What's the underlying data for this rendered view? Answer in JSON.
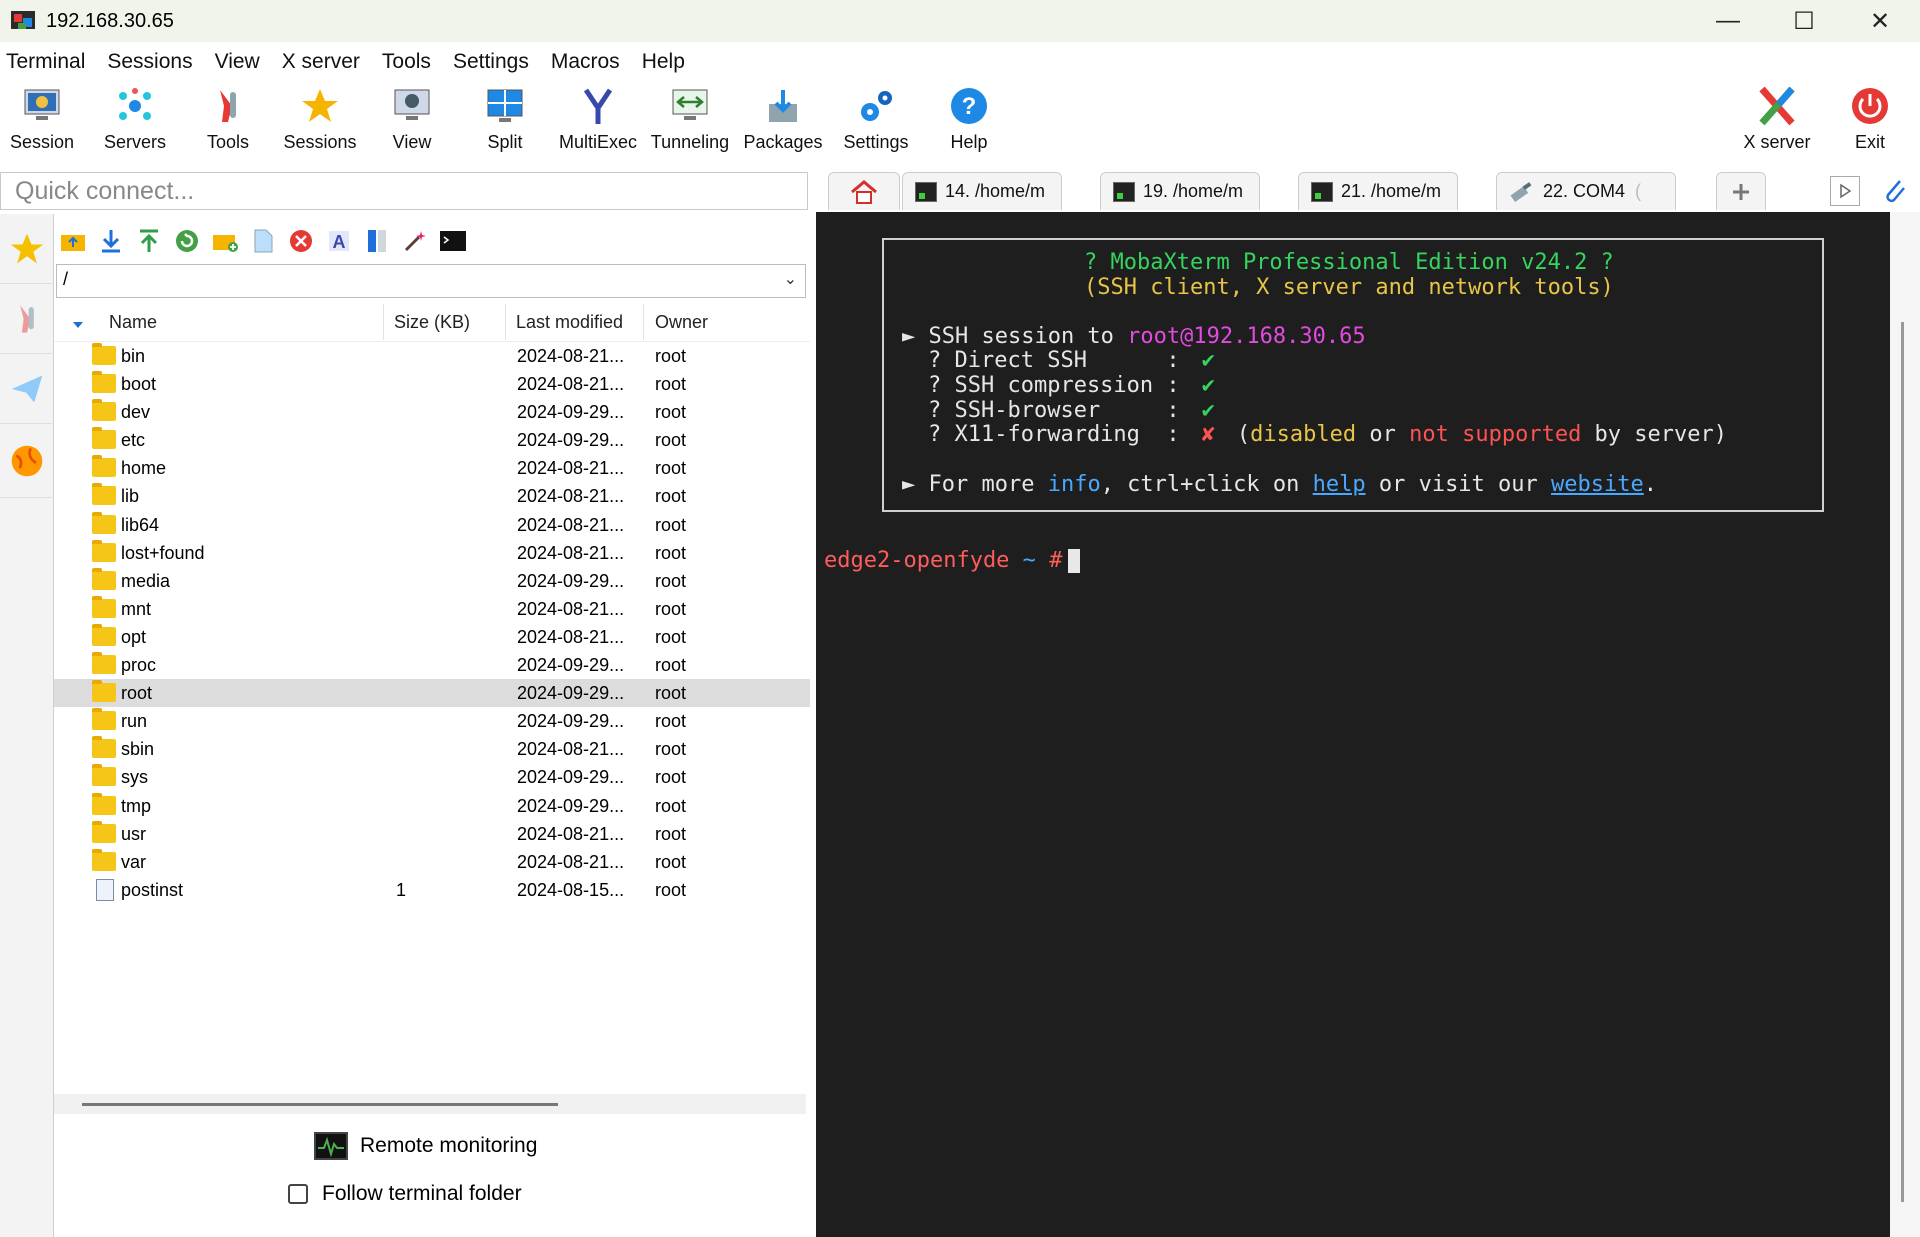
{
  "window": {
    "title": "192.168.30.65",
    "minimize": "—",
    "maximize": "☐",
    "close": "✕"
  },
  "menu": [
    "Terminal",
    "Sessions",
    "View",
    "X server",
    "Tools",
    "Settings",
    "Macros",
    "Help"
  ],
  "toolbar": {
    "session": "Session",
    "servers": "Servers",
    "tools": "Tools",
    "sessions": "Sessions",
    "view": "View",
    "split": "Split",
    "multiexec": "MultiExec",
    "tunneling": "Tunneling",
    "packages": "Packages",
    "settings": "Settings",
    "help": "Help",
    "xserver": "X server",
    "exit": "Exit"
  },
  "quick_connect": {
    "placeholder": "Quick connect..."
  },
  "tabs": [
    {
      "label": "14. /home/m",
      "fade": ""
    },
    {
      "label": "19. /home/m",
      "fade": ""
    },
    {
      "label": "21. /home/m",
      "fade": ""
    },
    {
      "label": "22. COM4",
      "fade": "("
    }
  ],
  "file_browser": {
    "path": "/",
    "columns": {
      "name": "Name",
      "size": "Size (KB)",
      "modified": "Last modified",
      "owner": "Owner"
    },
    "rows": [
      {
        "name": "bin",
        "size": "",
        "modified": "2024-08-21...",
        "owner": "root"
      },
      {
        "name": "boot",
        "size": "",
        "modified": "2024-08-21...",
        "owner": "root"
      },
      {
        "name": "dev",
        "size": "",
        "modified": "2024-09-29...",
        "owner": "root"
      },
      {
        "name": "etc",
        "size": "",
        "modified": "2024-09-29...",
        "owner": "root"
      },
      {
        "name": "home",
        "size": "",
        "modified": "2024-08-21...",
        "owner": "root"
      },
      {
        "name": "lib",
        "size": "",
        "modified": "2024-08-21...",
        "owner": "root"
      },
      {
        "name": "lib64",
        "size": "",
        "modified": "2024-08-21...",
        "owner": "root"
      },
      {
        "name": "lost+found",
        "size": "",
        "modified": "2024-08-21...",
        "owner": "root"
      },
      {
        "name": "media",
        "size": "",
        "modified": "2024-09-29...",
        "owner": "root"
      },
      {
        "name": "mnt",
        "size": "",
        "modified": "2024-08-21...",
        "owner": "root"
      },
      {
        "name": "opt",
        "size": "",
        "modified": "2024-08-21...",
        "owner": "root"
      },
      {
        "name": "proc",
        "size": "",
        "modified": "2024-09-29...",
        "owner": "root"
      },
      {
        "name": "root",
        "size": "",
        "modified": "2024-09-29...",
        "owner": "root"
      },
      {
        "name": "run",
        "size": "",
        "modified": "2024-09-29...",
        "owner": "root"
      },
      {
        "name": "sbin",
        "size": "",
        "modified": "2024-08-21...",
        "owner": "root"
      },
      {
        "name": "sys",
        "size": "",
        "modified": "2024-09-29...",
        "owner": "root"
      },
      {
        "name": "tmp",
        "size": "",
        "modified": "2024-09-29...",
        "owner": "root"
      },
      {
        "name": "usr",
        "size": "",
        "modified": "2024-08-21...",
        "owner": "root"
      },
      {
        "name": "var",
        "size": "",
        "modified": "2024-08-21...",
        "owner": "root"
      },
      {
        "name": "postinst",
        "size": "1",
        "modified": "2024-08-15...",
        "owner": "root"
      }
    ],
    "remote_monitoring": "Remote monitoring",
    "follow_terminal_folder": "Follow terminal folder"
  },
  "terminal": {
    "banner_title": "? MobaXterm Professional Edition v24.2 ?",
    "banner_subtitle": "(SSH client, X server and network tools)",
    "ssh_prefix": "► SSH session to ",
    "ssh_target": "root@192.168.30.65",
    "direct_ssh": "? Direct SSH      :",
    "ssh_compression": "? SSH compression :",
    "ssh_browser": "? SSH-browser     :",
    "x11_forwarding": "? X11-forwarding  :",
    "check": "✔",
    "cross": "✘",
    "paren_open": "(",
    "disabled": "disabled",
    "or": " or ",
    "not_supported": "not supported",
    "by_server": " by server)",
    "more_prefix": "► For more ",
    "info": "info",
    "ctrl_click": ", ctrl+click on ",
    "help": "help",
    "or_visit": " or visit our ",
    "website": "website",
    "period": ".",
    "prompt_host": "edge2-openfyde",
    "prompt_tilde": " ~ ",
    "prompt_hash": "#"
  }
}
